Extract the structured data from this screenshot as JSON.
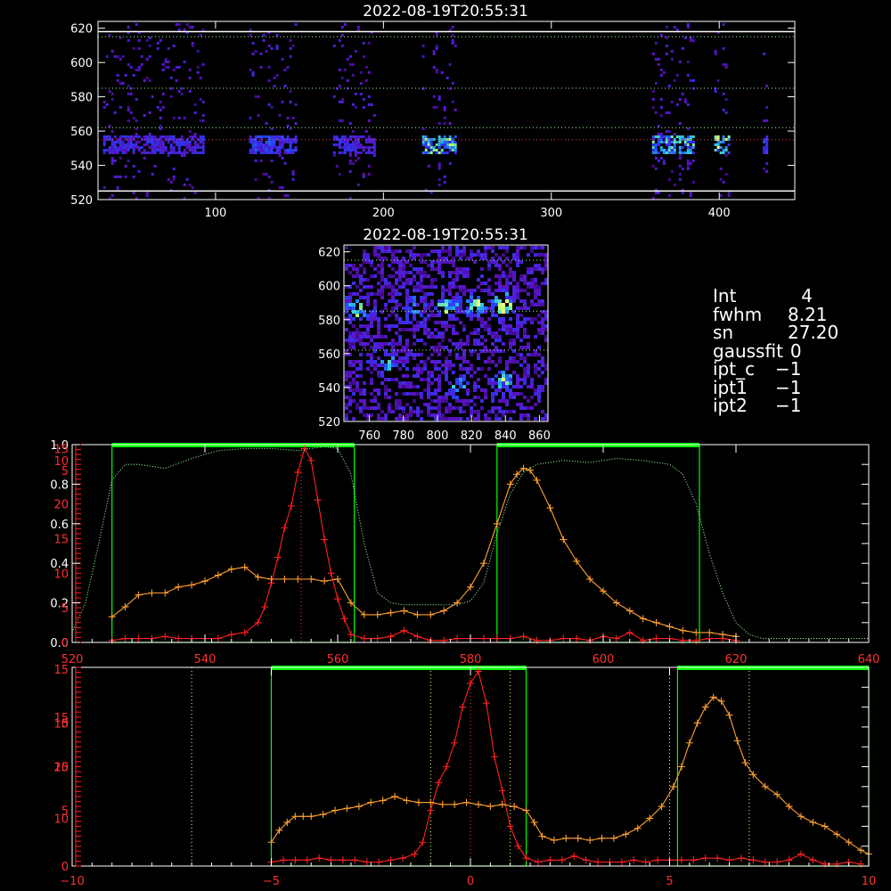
{
  "colors": {
    "background": "#000000",
    "axes": "#ffffff",
    "fit_bands": "#00ff00",
    "red_series": "#ff2020",
    "orange_series": "#ffa030",
    "green_dotted": "#99ff99",
    "yellow_dotted": "#ffff80"
  },
  "info": {
    "rows": [
      {
        "key": "Int",
        "value": "4"
      },
      {
        "key": "fwhm",
        "value": "8.21"
      },
      {
        "key": "sn",
        "value": "27.20"
      },
      {
        "key": "gaussfit",
        "value": "0"
      },
      {
        "key": "ipt_c",
        "value": "−1"
      },
      {
        "key": "ipt1",
        "value": "−1"
      },
      {
        "key": "ipt2",
        "value": "−1"
      }
    ]
  },
  "chart_data": [
    {
      "type": "heatmap",
      "title": "2022-08-19T20:55:31",
      "xlim": [
        30,
        445
      ],
      "ylim": [
        520,
        624
      ],
      "x_ticks": [
        "100",
        "200",
        "300",
        "400"
      ],
      "x_tick_values": [
        100,
        200,
        300,
        400
      ],
      "y_ticks": [
        "520",
        "540",
        "560",
        "580",
        "600",
        "620"
      ],
      "y_tick_values": [
        520,
        540,
        560,
        580,
        600,
        620
      ],
      "hlines": [
        {
          "y": 618,
          "style": "solid",
          "color": "#ffffff"
        },
        {
          "y": 615,
          "style": "dotted",
          "color": "#99ff99"
        },
        {
          "y": 585,
          "style": "dotted",
          "color": "#99ff99"
        },
        {
          "y": 562,
          "style": "dotted",
          "color": "#99ff99"
        },
        {
          "y": 555,
          "style": "dotted",
          "color": "#ff4040"
        },
        {
          "y": 525,
          "style": "solid",
          "color": "#ffffff"
        }
      ],
      "bands": [
        {
          "x": [
            33,
            92
          ],
          "peak": 0.55
        },
        {
          "x": [
            120,
            148
          ],
          "peak": 0.6
        },
        {
          "x": [
            170,
            195
          ],
          "peak": 0.55
        },
        {
          "x": [
            223,
            243
          ],
          "peak": 0.95
        },
        {
          "x": [
            360,
            385
          ],
          "peak": 0.85
        },
        {
          "x": [
            397,
            405
          ],
          "peak": 1.0
        },
        {
          "x": [
            426,
            429
          ],
          "peak": 0.6
        }
      ],
      "emission_center": 553
    },
    {
      "type": "heatmap",
      "title": "2022-08-19T20:55:31",
      "xlim": [
        745,
        865
      ],
      "ylim": [
        520,
        624
      ],
      "x_ticks": [
        "760",
        "780",
        "800",
        "820",
        "840",
        "860"
      ],
      "x_tick_values": [
        760,
        780,
        800,
        820,
        840,
        860
      ],
      "y_ticks": [
        "520",
        "540",
        "560",
        "580",
        "600",
        "620"
      ],
      "y_tick_values": [
        520,
        540,
        560,
        580,
        600,
        620
      ],
      "hlines": [
        {
          "y": 615,
          "style": "dotted",
          "color": "#99ff99"
        },
        {
          "y": 585,
          "style": "dotted",
          "color": "#99ff99"
        },
        {
          "y": 562,
          "style": "dotted",
          "color": "#99ff99"
        }
      ],
      "hotspots": [
        {
          "x": 752,
          "y": 587,
          "s": 0.7
        },
        {
          "x": 785,
          "y": 588,
          "s": 0.5
        },
        {
          "x": 805,
          "y": 589,
          "s": 0.7
        },
        {
          "x": 822,
          "y": 590,
          "s": 0.8
        },
        {
          "x": 838,
          "y": 590,
          "s": 1.0
        },
        {
          "x": 838,
          "y": 545,
          "s": 0.7
        },
        {
          "x": 810,
          "y": 542,
          "s": 0.5
        },
        {
          "x": 770,
          "y": 555,
          "s": 0.4
        }
      ]
    },
    {
      "type": "line",
      "xlim": [
        520,
        640
      ],
      "x_ticks": [
        "520",
        "540",
        "560",
        "580",
        "600",
        "620",
        "640"
      ],
      "x_tick_values": [
        520,
        540,
        560,
        580,
        600,
        620,
        640
      ],
      "left_axis_white": {
        "ticks": [
          "0.0",
          "0.2",
          "0.4",
          "0.6",
          "0.8",
          "1.0"
        ],
        "values": [
          0,
          0.2,
          0.4,
          0.6,
          0.8,
          1.0
        ],
        "ylim": [
          0,
          1.0
        ]
      },
      "left_axis_red": {
        "ticks": [
          "0",
          "5",
          "10",
          "15",
          "20",
          "5",
          "10",
          "15"
        ],
        "values": [
          0,
          0.175,
          0.35,
          0.525,
          0.7,
          0.87,
          0.92,
          0.98
        ]
      },
      "fit_bands": [
        [
          526,
          562.5
        ],
        [
          584,
          614.5
        ]
      ],
      "vlines_dotted": [
        {
          "x": 554.5,
          "color": "#ff4040"
        }
      ],
      "series": [
        {
          "style": "plus",
          "color": "#ff2020",
          "x": [
            526,
            528,
            530,
            532,
            534,
            536,
            538,
            540,
            542,
            544,
            546,
            548,
            549,
            550,
            551,
            552,
            553,
            554,
            555,
            556,
            557,
            558,
            559,
            560,
            561,
            562,
            564,
            566,
            568,
            570,
            572,
            574,
            576,
            578,
            580,
            582,
            584,
            586,
            588,
            590,
            592,
            594,
            596,
            598,
            600,
            602,
            604,
            606,
            608,
            610,
            612,
            614,
            616,
            618,
            620
          ],
          "y": [
            0.01,
            0.02,
            0.02,
            0.02,
            0.03,
            0.02,
            0.02,
            0.02,
            0.02,
            0.04,
            0.05,
            0.1,
            0.18,
            0.3,
            0.43,
            0.58,
            0.69,
            0.86,
            0.98,
            0.92,
            0.72,
            0.52,
            0.35,
            0.22,
            0.12,
            0.04,
            0.02,
            0.02,
            0.03,
            0.06,
            0.03,
            0.01,
            0.01,
            0.02,
            0.02,
            0.02,
            0.02,
            0.02,
            0.03,
            0.01,
            0.01,
            0.02,
            0.02,
            0.01,
            0.03,
            0.02,
            0.05,
            0.01,
            0.02,
            0.02,
            0.01,
            0.01,
            0.02,
            0.02,
            0.01
          ]
        },
        {
          "style": "plus",
          "color": "#ffa030",
          "x": [
            526,
            528,
            530,
            532,
            534,
            536,
            538,
            540,
            542,
            544,
            546,
            548,
            550,
            552,
            554,
            556,
            558,
            560,
            562,
            564,
            566,
            568,
            570,
            572,
            574,
            576,
            578,
            580,
            582,
            584,
            586,
            587,
            588,
            589,
            590,
            592,
            594,
            596,
            598,
            600,
            602,
            604,
            606,
            608,
            610,
            612,
            614,
            616,
            618,
            620
          ],
          "y": [
            0.13,
            0.18,
            0.24,
            0.25,
            0.25,
            0.28,
            0.29,
            0.31,
            0.34,
            0.37,
            0.38,
            0.33,
            0.32,
            0.32,
            0.32,
            0.32,
            0.31,
            0.32,
            0.2,
            0.14,
            0.14,
            0.15,
            0.16,
            0.14,
            0.14,
            0.16,
            0.2,
            0.28,
            0.4,
            0.6,
            0.8,
            0.85,
            0.88,
            0.87,
            0.82,
            0.68,
            0.52,
            0.41,
            0.32,
            0.26,
            0.2,
            0.16,
            0.12,
            0.1,
            0.08,
            0.06,
            0.05,
            0.05,
            0.04,
            0.03
          ]
        },
        {
          "style": "dotted",
          "color": "#99ff99",
          "x": [
            520,
            522,
            524,
            526,
            528,
            530,
            534,
            538,
            542,
            546,
            550,
            554,
            558,
            560,
            562,
            564,
            566,
            568,
            570,
            574,
            578,
            580,
            582,
            584,
            586,
            588,
            590,
            594,
            598,
            602,
            606,
            610,
            612,
            614,
            616,
            618,
            620,
            622,
            624,
            630,
            636,
            640
          ],
          "y": [
            0.05,
            0.2,
            0.5,
            0.82,
            0.9,
            0.9,
            0.88,
            0.93,
            0.97,
            0.98,
            0.98,
            0.97,
            0.99,
            0.98,
            0.85,
            0.5,
            0.25,
            0.2,
            0.19,
            0.19,
            0.19,
            0.21,
            0.3,
            0.55,
            0.75,
            0.86,
            0.9,
            0.92,
            0.91,
            0.93,
            0.92,
            0.9,
            0.85,
            0.7,
            0.45,
            0.25,
            0.1,
            0.04,
            0.02,
            0.02,
            0.02,
            0.02
          ]
        }
      ]
    },
    {
      "type": "line",
      "xlim": [
        -10,
        10
      ],
      "x_ticks": [
        "−10",
        "−5",
        "0",
        "5",
        "10"
      ],
      "x_tick_values": [
        -10,
        -5,
        0,
        5,
        10
      ],
      "left_axis_red": {
        "ticks": [
          "0",
          "5",
          "10",
          "15",
          "20",
          "5",
          "10",
          "15",
          "15"
        ],
        "values": [
          0,
          0.28,
          0.24,
          0.5,
          0.5,
          0.72,
          0.72,
          0.75,
          0.99
        ]
      },
      "fit_bands": [
        [
          -5,
          1.4
        ],
        [
          5.2,
          10
        ]
      ],
      "vlines_dotted": [
        {
          "x": -7,
          "color": "#ffff80"
        },
        {
          "x": -1,
          "color": "#ffff80"
        },
        {
          "x": 0,
          "color": "#ff4040"
        },
        {
          "x": 1,
          "color": "#ffff80"
        },
        {
          "x": 5,
          "color": "#ffff80"
        },
        {
          "x": 7,
          "color": "#ffff80"
        }
      ],
      "series": [
        {
          "style": "plus",
          "color": "#ff2020",
          "x": [
            -5,
            -4.7,
            -4.4,
            -4.1,
            -3.8,
            -3.5,
            -3.2,
            -2.9,
            -2.6,
            -2.3,
            -2.0,
            -1.7,
            -1.4,
            -1.2,
            -1.0,
            -0.8,
            -0.6,
            -0.4,
            -0.2,
            0,
            0.2,
            0.4,
            0.6,
            0.8,
            1.0,
            1.2,
            1.4,
            1.7,
            2.0,
            2.3,
            2.6,
            2.9,
            3.2,
            3.5,
            3.8,
            4.1,
            4.4,
            4.7,
            5.0,
            5.3,
            5.6,
            5.9,
            6.2,
            6.5,
            6.8,
            7.1,
            7.4,
            7.7,
            8.0,
            8.3,
            8.6,
            8.9,
            9.2,
            9.5,
            9.8
          ],
          "y": [
            0.02,
            0.03,
            0.03,
            0.03,
            0.04,
            0.03,
            0.03,
            0.03,
            0.02,
            0.02,
            0.03,
            0.04,
            0.06,
            0.12,
            0.28,
            0.42,
            0.5,
            0.62,
            0.8,
            0.92,
            0.98,
            0.82,
            0.55,
            0.38,
            0.2,
            0.1,
            0.04,
            0.02,
            0.03,
            0.03,
            0.05,
            0.03,
            0.02,
            0.02,
            0.02,
            0.03,
            0.02,
            0.03,
            0.03,
            0.03,
            0.03,
            0.04,
            0.04,
            0.03,
            0.04,
            0.03,
            0.02,
            0.02,
            0.03,
            0.06,
            0.03,
            0.01,
            0.01,
            0.02,
            0.01
          ]
        },
        {
          "style": "plus",
          "color": "#ffa030",
          "x": [
            -5,
            -4.8,
            -4.6,
            -4.4,
            -4.2,
            -4.0,
            -3.7,
            -3.4,
            -3.1,
            -2.8,
            -2.5,
            -2.2,
            -1.9,
            -1.6,
            -1.3,
            -1.0,
            -0.7,
            -0.4,
            -0.1,
            0.2,
            0.5,
            0.8,
            1.1,
            1.4,
            1.6,
            1.8,
            2.1,
            2.4,
            2.7,
            3.0,
            3.3,
            3.6,
            3.9,
            4.2,
            4.5,
            4.8,
            5.1,
            5.3,
            5.5,
            5.7,
            5.9,
            6.1,
            6.3,
            6.5,
            6.7,
            6.9,
            7.1,
            7.4,
            7.7,
            8.0,
            8.3,
            8.6,
            8.9,
            9.2,
            9.5,
            9.8,
            10.0
          ],
          "y": [
            0.12,
            0.18,
            0.22,
            0.25,
            0.25,
            0.25,
            0.26,
            0.28,
            0.29,
            0.3,
            0.32,
            0.33,
            0.35,
            0.33,
            0.32,
            0.32,
            0.31,
            0.31,
            0.32,
            0.31,
            0.3,
            0.31,
            0.3,
            0.28,
            0.22,
            0.15,
            0.13,
            0.14,
            0.14,
            0.13,
            0.14,
            0.14,
            0.16,
            0.19,
            0.24,
            0.3,
            0.4,
            0.5,
            0.62,
            0.72,
            0.8,
            0.85,
            0.83,
            0.76,
            0.63,
            0.52,
            0.46,
            0.4,
            0.36,
            0.3,
            0.25,
            0.22,
            0.2,
            0.16,
            0.12,
            0.08,
            0.06
          ]
        }
      ]
    }
  ]
}
